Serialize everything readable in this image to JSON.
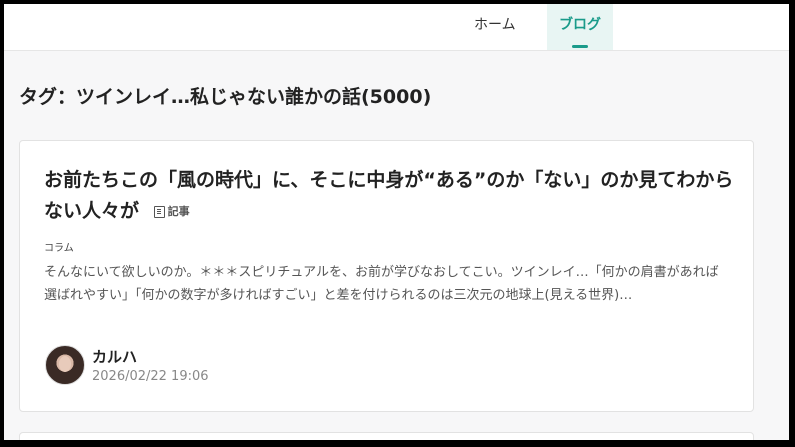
{
  "nav": {
    "home": "ホーム",
    "blog": "ブログ"
  },
  "page": {
    "tag_title": "タグ：ツインレイ…私じゃない誰かの話(5000)"
  },
  "article": {
    "title": "お前たちこの「風の時代」に、そこに中身が“ある”のか「ない」のか見てわからない人々が",
    "kind": "記事",
    "category": "コラム",
    "excerpt": "そんなにいて欲しいのか。＊＊＊スピリチュアルを、お前が学びなおしてこい。ツインレイ…「何かの肩書があれば選ばれやすい」「何かの数字が多ければすごい」と差を付けられるのは三次元の地球上(見える世界)…",
    "author": "カルハ",
    "date": "2026/02/22 19:06"
  }
}
